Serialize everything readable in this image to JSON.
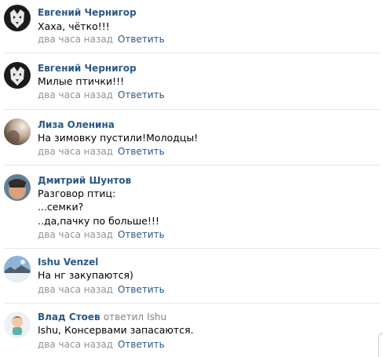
{
  "comments": [
    {
      "author": "Евгений Чернигор",
      "lines": [
        "Хаха, чётко!!!"
      ],
      "time": "два часа назад",
      "reply_label": "Ответить",
      "avatar_icon": "wolf-avatar"
    },
    {
      "author": "Евгений Чернигор",
      "lines": [
        "Милые птички!!!"
      ],
      "time": "два часа назад",
      "reply_label": "Ответить",
      "avatar_icon": "wolf-avatar"
    },
    {
      "author": "Лиза Оленина",
      "lines": [
        "На зимовку пустили!Молодцы!"
      ],
      "time": "два часа назад",
      "reply_label": "Ответить",
      "avatar_icon": "photo-avatar"
    },
    {
      "author": "Дмитрий Шунтов",
      "lines": [
        "Разговор птиц:",
        "...семки?",
        "..да,пачку по больше!!!"
      ],
      "time": "два часа назад",
      "reply_label": "Ответить",
      "avatar_icon": "photo-avatar"
    },
    {
      "author": "Ishu Venzel",
      "lines": [
        "На нг закупаются)"
      ],
      "time": "два часа назад",
      "reply_label": "Ответить",
      "avatar_icon": "photo-avatar"
    },
    {
      "author": "Влад Стоев",
      "reply_meta": "ответил",
      "reply_to": "Ishu",
      "lines": [
        "Ishu, Консервами запасаются."
      ],
      "time": "два часа назад",
      "reply_label": "Ответить",
      "avatar_icon": "cartoon-avatar"
    }
  ],
  "colors": {
    "author": "#2a5885",
    "meta": "#939393",
    "divider": "#e7e8ec"
  }
}
